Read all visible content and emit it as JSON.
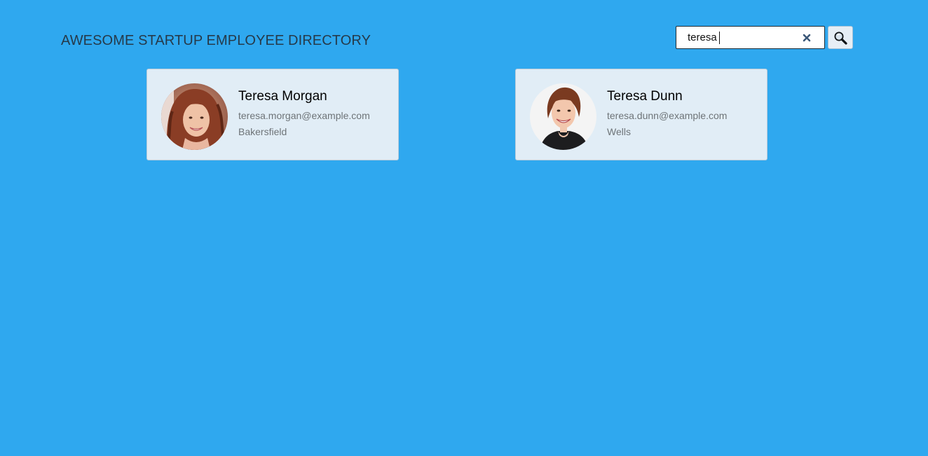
{
  "header": {
    "title": "AWESOME STARTUP EMPLOYEE DIRECTORY"
  },
  "search": {
    "value": "teresa",
    "clear_icon": "close-icon",
    "button_icon": "search-icon"
  },
  "colors": {
    "background": "#2fa8ef",
    "card": "#e1edf6",
    "title": "#263a4a",
    "muted_text": "#6e7478"
  },
  "employees": [
    {
      "name": "Teresa Morgan",
      "email": "teresa.morgan@example.com",
      "city": "Bakersfield",
      "avatar_icon": "avatar-photo"
    },
    {
      "name": "Teresa Dunn",
      "email": "teresa.dunn@example.com",
      "city": "Wells",
      "avatar_icon": "avatar-photo"
    }
  ]
}
